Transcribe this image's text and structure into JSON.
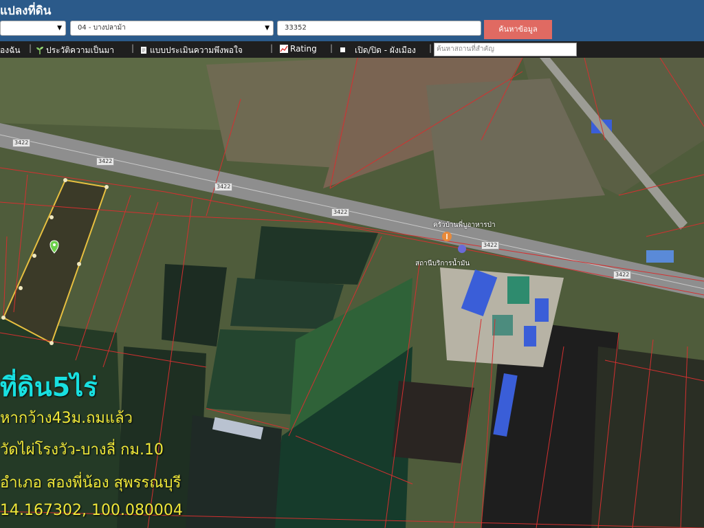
{
  "header": {
    "title": "แปลงที่ดิน",
    "district_select": "04 - บางปลาม้า",
    "parcel_input": "33352",
    "search_button": "ค้นหาข้อมูล"
  },
  "toolbar": {
    "item_1": "องฉัน",
    "item_2": "ประวัติความเป็นมา",
    "item_3": "แบบประเมินความพึงพอใจ",
    "item_4": "Rating",
    "item_5": "เปิด/ปิด - ผังเมือง",
    "place_search_placeholder": "ค้นหาสถานที่สำคัญ"
  },
  "map": {
    "road_labels": [
      "3422",
      "3422",
      "3422",
      "3422",
      "3422",
      "3422"
    ],
    "poi_1": "ครัวบ้านพี่บูอาหารป่า",
    "poi_2": "สถานีบริการน้ำมัน"
  },
  "overlay": {
    "line_1": "ที่ดิน5ไร่",
    "line_2": "หากว้าง43ม.ถมแล้ว",
    "line_3": "วัดไผ่โรงวัว-บางลี่ กม.10",
    "line_4": "อำเภอ สองพี่น้อง สุพรรณบุรี",
    "line_5": "14.167302, 100.080004"
  },
  "colors": {
    "header_bg": "#2b5a8a",
    "search_button": "#e06a62",
    "toolbar_bg": "#1f1f1f",
    "overlay_title": "#18e0e0",
    "overlay_text": "#f0e83a"
  }
}
